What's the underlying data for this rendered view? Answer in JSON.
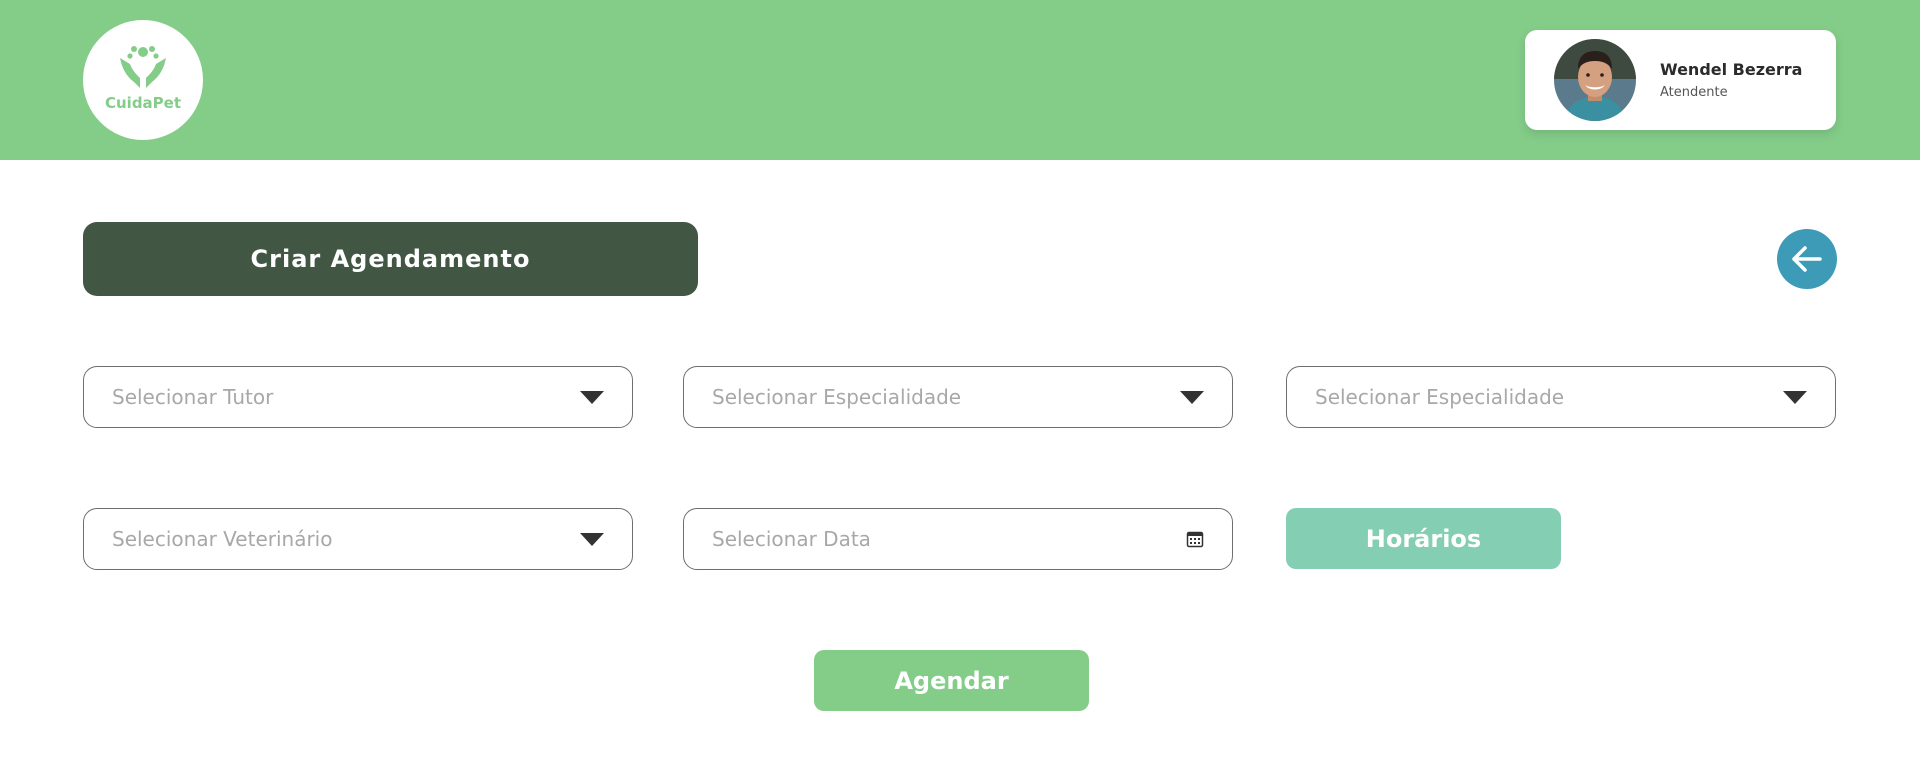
{
  "brand": {
    "name": "CuidaPet",
    "color": "#84cd89"
  },
  "user": {
    "name": "Wendel Bezerra",
    "role": "Atendente"
  },
  "page": {
    "title": "Criar Agendamento"
  },
  "form": {
    "tutor": {
      "placeholder": "Selecionar Tutor"
    },
    "especialidade_1": {
      "placeholder": "Selecionar Especialidade"
    },
    "especialidade_2": {
      "placeholder": "Selecionar Especialidade"
    },
    "veterinario": {
      "placeholder": "Selecionar Veterinário"
    },
    "data": {
      "placeholder": "Selecionar Data"
    },
    "horarios_label": "Horários",
    "agendar_label": "Agendar"
  },
  "icons": {
    "back": "arrow-left-icon",
    "dropdown": "triangle-down-icon",
    "calendar": "calendar-icon",
    "logo": "paw-hands-icon"
  },
  "colors": {
    "header": "#84cd89",
    "title_bar": "#415743",
    "back_button": "#3d9bb8",
    "horarios": "#84cfb3",
    "agendar": "#84cd89"
  }
}
